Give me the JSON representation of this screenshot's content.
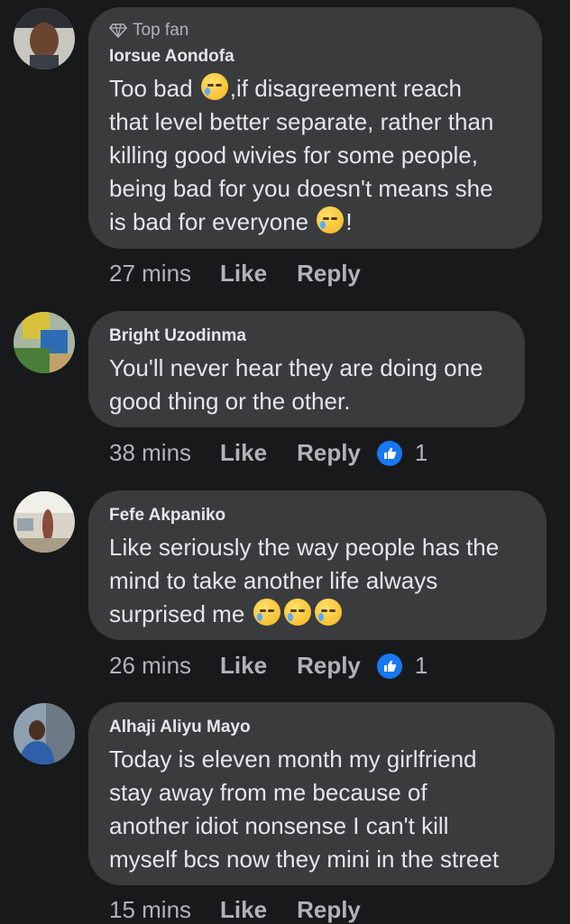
{
  "comments": [
    {
      "badge": "Top fan",
      "name": "Iorsue Aondofa",
      "lines": [
        "Too bad [e],if disagreement reach",
        "that level better separate, rather than",
        "killing good wivies for some people,",
        "being bad for you doesn't means she",
        "is bad for everyone [e]!"
      ],
      "line1_a": "Too bad ",
      "line1_b": ",if disagreement reach",
      "line2": "that level better separate, rather than",
      "line3": "killing good wivies for some people,",
      "line4": "being bad for you doesn't means she",
      "line5_a": "is bad for everyone ",
      "line5_b": "!",
      "time": "27 mins",
      "like": "Like",
      "reply": "Reply"
    },
    {
      "name": "Bright Uzodinma",
      "line1": "You'll never hear they are doing one",
      "line2": "good thing or the other.",
      "time": "38 mins",
      "like": "Like",
      "reply": "Reply",
      "reaction_count": "1"
    },
    {
      "name": "Fefe Akpaniko",
      "line1": "Like seriously the way people has the",
      "line2": "mind to take another life always",
      "line3": "surprised me ",
      "time": "26 mins",
      "like": "Like",
      "reply": "Reply",
      "reaction_count": "1"
    },
    {
      "name": "Alhaji Aliyu Mayo",
      "line1": "Today is eleven month my girlfriend",
      "line2": "stay away from me because of",
      "line3": "another idiot nonsense I can't kill",
      "line4": "myself bcs now they mini in the street",
      "time": "15 mins",
      "like": "Like",
      "reply": "Reply"
    }
  ],
  "colors": {
    "background": "#18191a",
    "bubble": "#3a3b3c",
    "text": "#e4e6eb",
    "muted": "#b0b3b8",
    "like_blue": "#1877f2"
  },
  "icons": {
    "badge": "diamond-icon",
    "reaction": "thumbs-up-icon",
    "emoji": "crying-face-icon"
  }
}
